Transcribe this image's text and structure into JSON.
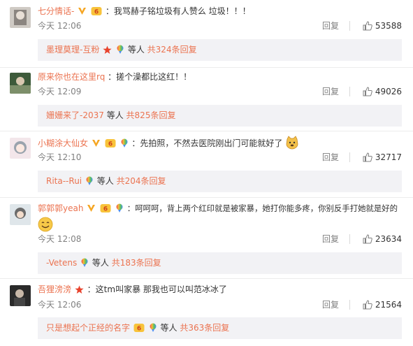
{
  "comments": [
    {
      "username": "七分情话-",
      "text": "：我骂赫子铭垃圾有人赞么 垃圾！！！",
      "time": "今天 12:06",
      "reply_label": "回复",
      "likes": "53588",
      "sub_user": "墨理莫理-互粉",
      "sub_mid": "等人",
      "sub_total": "共324条回复"
    },
    {
      "username": "原来你也在这里rq",
      "text": "：搓个澡都比这红！！",
      "time": "今天 12:09",
      "reply_label": "回复",
      "likes": "49026",
      "sub_user": "姗姗来了-2037",
      "sub_mid": "等人",
      "sub_total": "共825条回复"
    },
    {
      "username": "小糊涂大仙女",
      "text": "：先拍照，不然去医院刚出门可能就好了",
      "time": "今天 12:10",
      "reply_label": "回复",
      "likes": "32717",
      "sub_user": "Rita--Rui",
      "sub_mid": "等人",
      "sub_total": "共204条回复"
    },
    {
      "username": "郭郭郭yeah",
      "text": "：呵呵呵，背上两个红印就是被家暴，她打你能多疼，你别反手打她就是好的",
      "time": "今天 12:08",
      "reply_label": "回复",
      "likes": "23634",
      "sub_user": "-Vetens",
      "sub_mid": "等人",
      "sub_total": "共183条回复"
    },
    {
      "username": "吾狸滂滂",
      "text": "：这tm叫家暴 那我也可以叫范冰冰了",
      "time": "今天 12:06",
      "reply_label": "回复",
      "likes": "21564",
      "sub_user": "只是想起个正经的名字",
      "sub_mid": "等人",
      "sub_total": "共363条回复"
    }
  ],
  "icons": {
    "verified": "v-badge-icon",
    "member": "vip-badge-icon",
    "medal": "rainbow-medal-icon",
    "star": "star-icon",
    "like": "thumb-up-icon",
    "emoji_dog": "doge-emoji-icon",
    "emoji_smile": "smile-emoji-icon"
  },
  "colors": {
    "username": "#eb7350",
    "meta": "#808080",
    "subbox": "#f2f2f5",
    "star": "#e8432d",
    "verified": "#f5a623"
  }
}
